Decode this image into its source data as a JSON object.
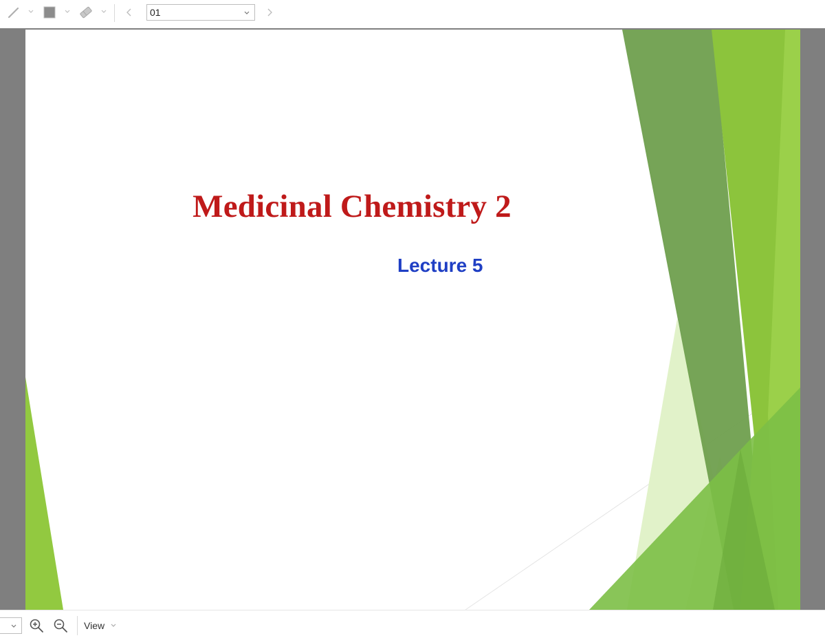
{
  "toolbar": {
    "icons": [
      "pen-icon",
      "fill-color-icon",
      "eraser-icon",
      "chevron-left-icon",
      "chevron-right-icon"
    ],
    "page_select_value": "01"
  },
  "slide": {
    "title": "Medicinal Chemistry 2",
    "subtitle": "Lecture 5",
    "colors": {
      "title": "#bf1a1a",
      "subtitle": "#1f3fc4",
      "green_dark": "#6e9e4b",
      "green_light": "#8dc63f"
    }
  },
  "bottom_bar": {
    "icons": [
      "zoom-in-icon",
      "zoom-out-icon"
    ],
    "view_label": "View"
  }
}
